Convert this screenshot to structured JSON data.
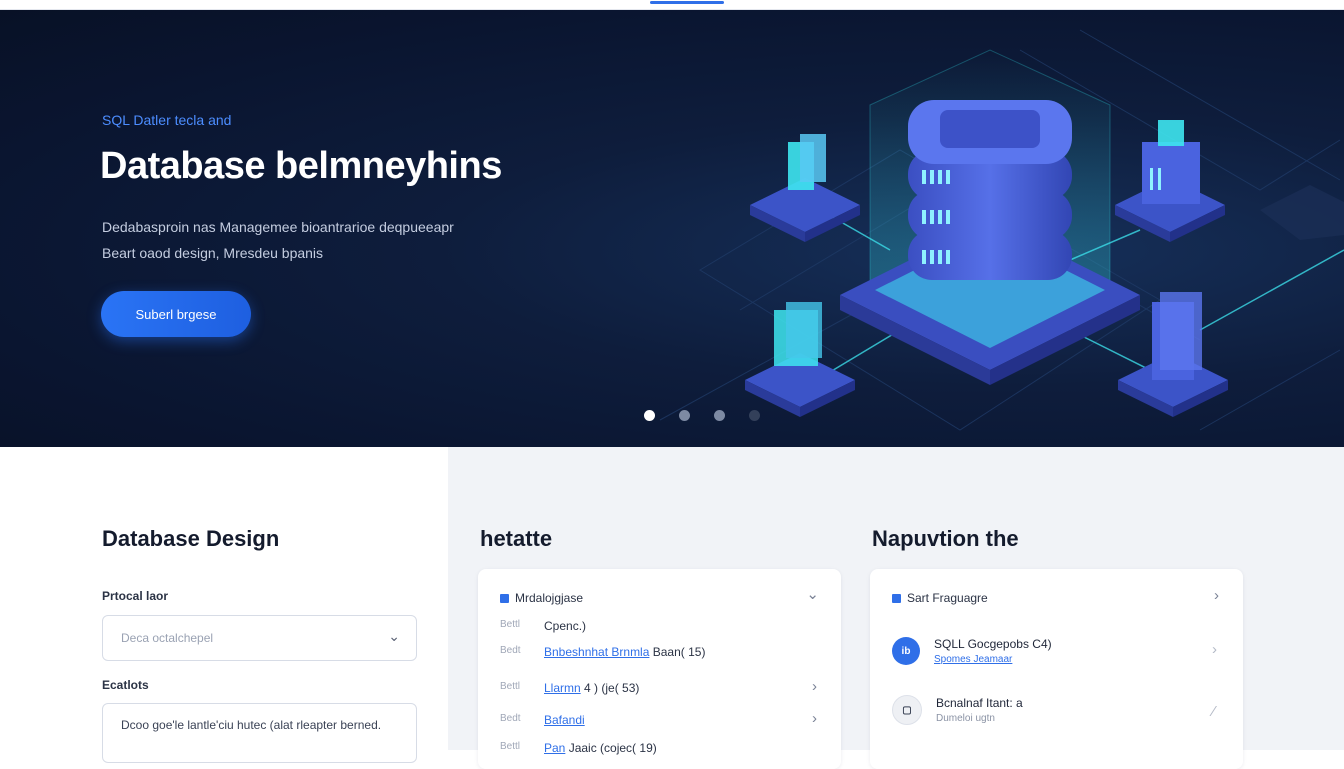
{
  "hero": {
    "eyebrow": "SQL Datler tecla and",
    "title": "Database belmneyhins",
    "description_line1": "Dedabasproin nas Managemee bioantrarioe deqpueeapr",
    "description_line2": "Beart oaod design, Mresdeu bpanis",
    "cta_label": "Suberl brgese",
    "carousel": {
      "slide_count": 4,
      "active_index": 0
    }
  },
  "design": {
    "title": "Database Design",
    "field1_label": "Prtocal laor",
    "field1_placeholder": "Deca octalchepel",
    "field2_label": "Ecatlots",
    "field2_value": "Dcoo goe'le lantle'ciu hutec (alat rleapter berned."
  },
  "middle": {
    "title": "hetatte",
    "card_header": "Mrdalojgjase",
    "rows": [
      {
        "key": "Bettl",
        "value": "Cpenc.)",
        "link": "",
        "extra": ""
      },
      {
        "key": "Bedt",
        "value": "",
        "link": "Bnbeshnhat Brnmla",
        "extra": "Baan( 15)"
      },
      {
        "key": "Bettl",
        "value": "",
        "link": "Llarmn",
        "extra": "4 ) (je( 53)"
      },
      {
        "key": "Bedt",
        "value": "",
        "link": "Bafandi",
        "extra": ""
      },
      {
        "key": "Bettl",
        "value": "",
        "link": "Pan",
        "extra": "Jaaic (cojec( 19)"
      }
    ]
  },
  "right": {
    "title": "Napuvtion the",
    "card_header": "Sart Fraguagre",
    "items": [
      {
        "avatar": "ib",
        "primary": "SQLL Gocgepobs C4)",
        "secondary": "Spomes Jeamaar"
      },
      {
        "avatar": "▢",
        "primary": "Bcnalnaf Itant: a",
        "secondary": "Dumeloi ugtn"
      }
    ]
  },
  "colors": {
    "accent": "#2f6fe8",
    "hero_bg": "#0e1d3c",
    "cyan": "#3ee6f0"
  }
}
